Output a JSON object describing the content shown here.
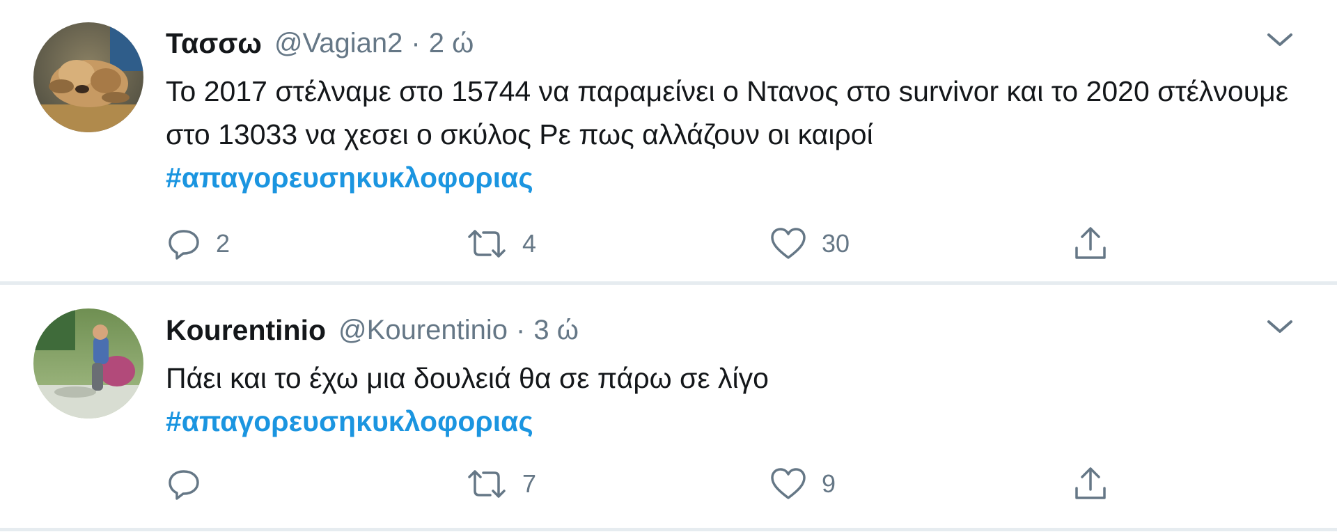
{
  "tweets": [
    {
      "name": "Τασσω",
      "handle": "@Vagian2",
      "separator": "·",
      "time": "2 ώ",
      "text": "Το 2017 στέλναμε στο 15744 να παραμείνει ο Ντανος στο survivor και το 2020 στέλνουμε στο 13033 να χεσει ο σκύλος Ρε πως αλλάζουν οι καιροί",
      "hashtag": "#απαγορευσηκυκλοφοριας",
      "reply_count": "2",
      "retweet_count": "4",
      "like_count": "30"
    },
    {
      "name": "Kourentinio",
      "handle": "@Kourentinio",
      "separator": "·",
      "time": "3 ώ",
      "text": "Πάει και το έχω μια δουλειά θα σε πάρω σε λίγο",
      "hashtag": "#απαγορευσηκυκλοφοριας",
      "reply_count": "",
      "retweet_count": "7",
      "like_count": "9"
    }
  ],
  "icons": {
    "reply": "reply-icon",
    "retweet": "retweet-icon",
    "like": "heart-icon",
    "share": "share-icon",
    "menu": "chevron-down-icon"
  },
  "colors": {
    "text": "#14171a",
    "secondary": "#657786",
    "link": "#1b95e0",
    "divider": "#e6ecf0"
  }
}
